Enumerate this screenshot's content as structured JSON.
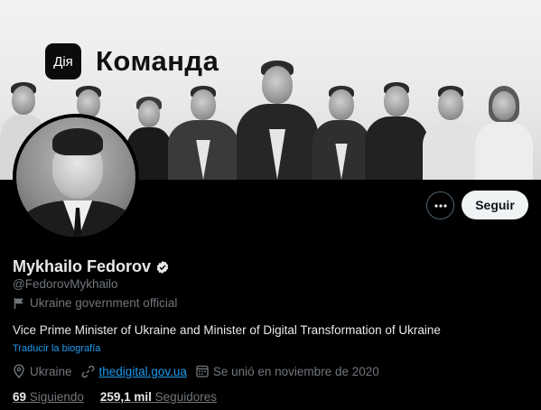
{
  "banner": {
    "logo_text": "Дія",
    "title": "Команда"
  },
  "profile": {
    "name": "Mykhailo Fedorov",
    "handle": "@FedorovMykhailo",
    "label": "Ukraine government official",
    "bio": "Vice Prime Minister of Ukraine and Minister of Digital Transformation of Ukraine",
    "translate_link": "Traducir la biografía",
    "location": "Ukraine",
    "website": "thedigital.gov.ua",
    "joined": "Se unió en noviembre de 2020"
  },
  "actions": {
    "follow_label": "Seguir"
  },
  "stats": {
    "following_count": "69",
    "following_label": "Siguiendo",
    "followers_count": "259,1 mil",
    "followers_label": "Seguidores"
  },
  "colors": {
    "accent": "#1d9bf0",
    "background": "#000000",
    "secondary_text": "#71767b",
    "primary_text": "#e7e9ea"
  }
}
